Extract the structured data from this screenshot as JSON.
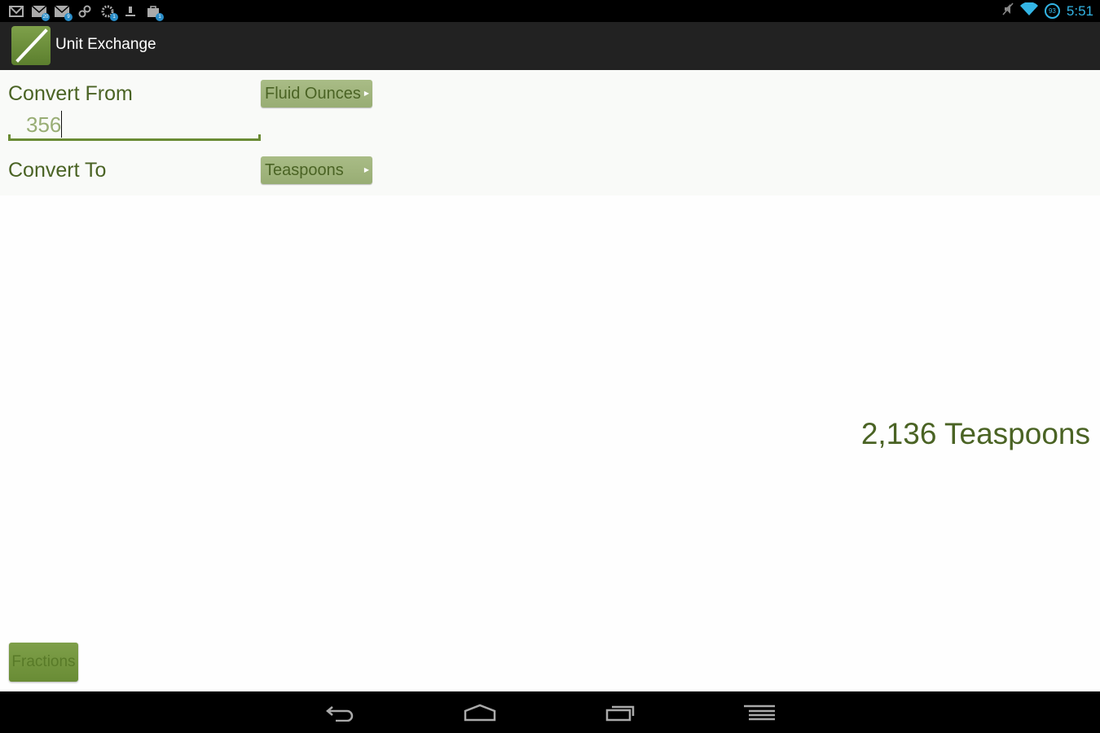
{
  "status_bar": {
    "notifications": [
      {
        "icon": "gmail-icon"
      },
      {
        "icon": "email-icon",
        "badge": "20"
      },
      {
        "icon": "email-icon",
        "badge": "9"
      },
      {
        "icon": "link-icon"
      },
      {
        "icon": "settings-update-icon",
        "badge": "1"
      },
      {
        "icon": "download-icon"
      },
      {
        "icon": "store-update-icon",
        "badge": "1"
      }
    ],
    "battery_level": "93",
    "time": "5:51"
  },
  "action_bar": {
    "title": "Unit Exchange"
  },
  "form": {
    "from_label": "Convert From",
    "from_unit": "Fluid Ounces",
    "input_value": "356",
    "to_label": "Convert To",
    "to_unit": "Teaspoons"
  },
  "result": {
    "text": "2,136 Teaspoons"
  },
  "fractions_button": "Fractions",
  "colors": {
    "accent": "#6a8b34",
    "text_green": "#4a6324",
    "spinner_bg": "#a9bc86",
    "status_blue": "#33b5e5"
  }
}
